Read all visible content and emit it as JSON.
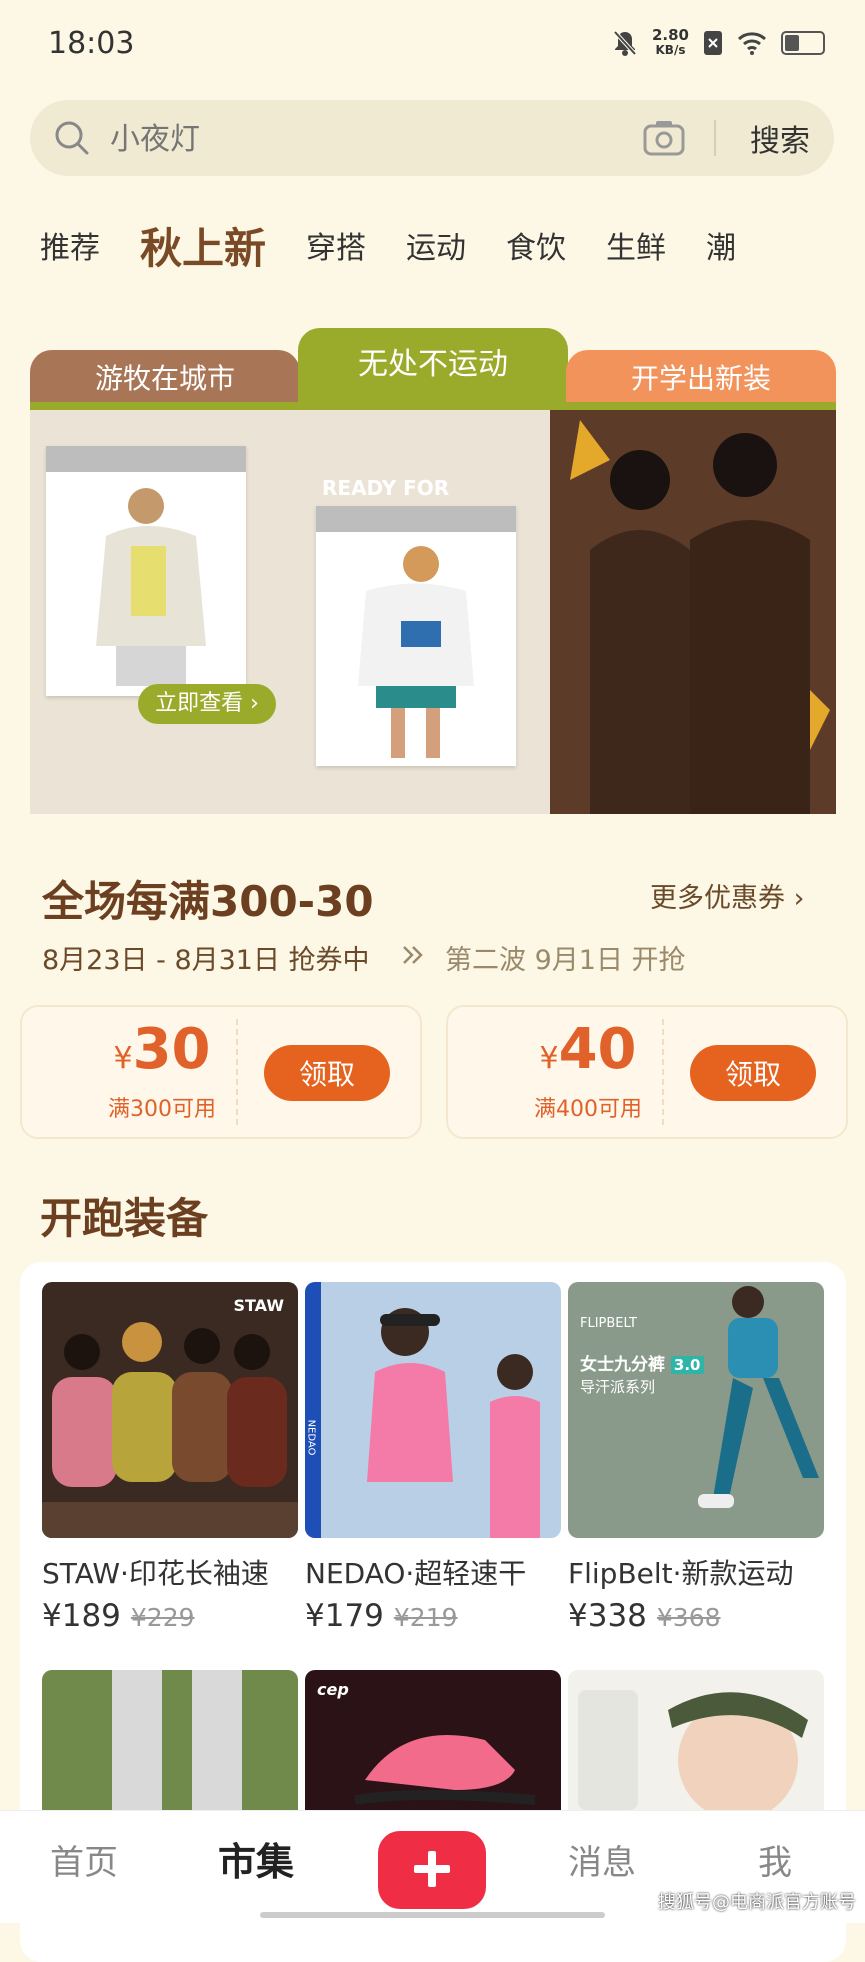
{
  "status_bar": {
    "time": "18:03",
    "speed_value": "2.80",
    "speed_unit": "KB/s"
  },
  "search": {
    "placeholder": "小夜灯",
    "button": "搜索"
  },
  "tabs": [
    "推荐",
    "秋上新",
    "穿搭",
    "运动",
    "食饮",
    "生鲜",
    "潮"
  ],
  "active_tab": "秋上新",
  "category_tabs": [
    {
      "label": "游牧在城市",
      "color": "#a87656"
    },
    {
      "label": "无处不运动",
      "color": "#9aab2c"
    },
    {
      "label": "开学出新装",
      "color": "#f2935c"
    }
  ],
  "banner": {
    "cta": "立即查看",
    "photo_text": "READY FOR",
    "accent": "#9aab2c"
  },
  "promo": {
    "title": "全场每满300-30",
    "more": "更多优惠券",
    "dates": "8月23日 - 8月31日 抢券中",
    "next": "第二波 9月1日 开抢"
  },
  "coupons": [
    {
      "yen": "¥",
      "amount": "30",
      "condition": "满300可用",
      "button": "领取"
    },
    {
      "yen": "¥",
      "amount": "40",
      "condition": "满400可用",
      "button": "领取"
    }
  ],
  "section_title": "开跑装备",
  "products": [
    {
      "name": "STAW·印花长袖速",
      "price": "¥189",
      "orig": "¥229",
      "brand": "STAW"
    },
    {
      "name": "NEDAO·超轻速干",
      "price": "¥179",
      "orig": "¥219",
      "brand": "NEDAO"
    },
    {
      "name": "FlipBelt·新款运动",
      "price": "¥338",
      "orig": "¥368",
      "brand": "FLIPBELT",
      "tag": "女士九分裤",
      "tag_version": "3.0",
      "sub": "导汗派系列"
    }
  ],
  "products_row2": [
    {
      "brand": ""
    },
    {
      "brand": "cep"
    },
    {
      "brand": ""
    }
  ],
  "bottom_nav": {
    "home": "首页",
    "market": "市集",
    "messages": "消息",
    "me": "我"
  },
  "watermark": "搜狐号@电商派官方账号",
  "colors": {
    "background": "#fdf8e6",
    "accent": "#e5621f",
    "brand_brown": "#6b3f1f",
    "add_red": "#ef2d45"
  }
}
